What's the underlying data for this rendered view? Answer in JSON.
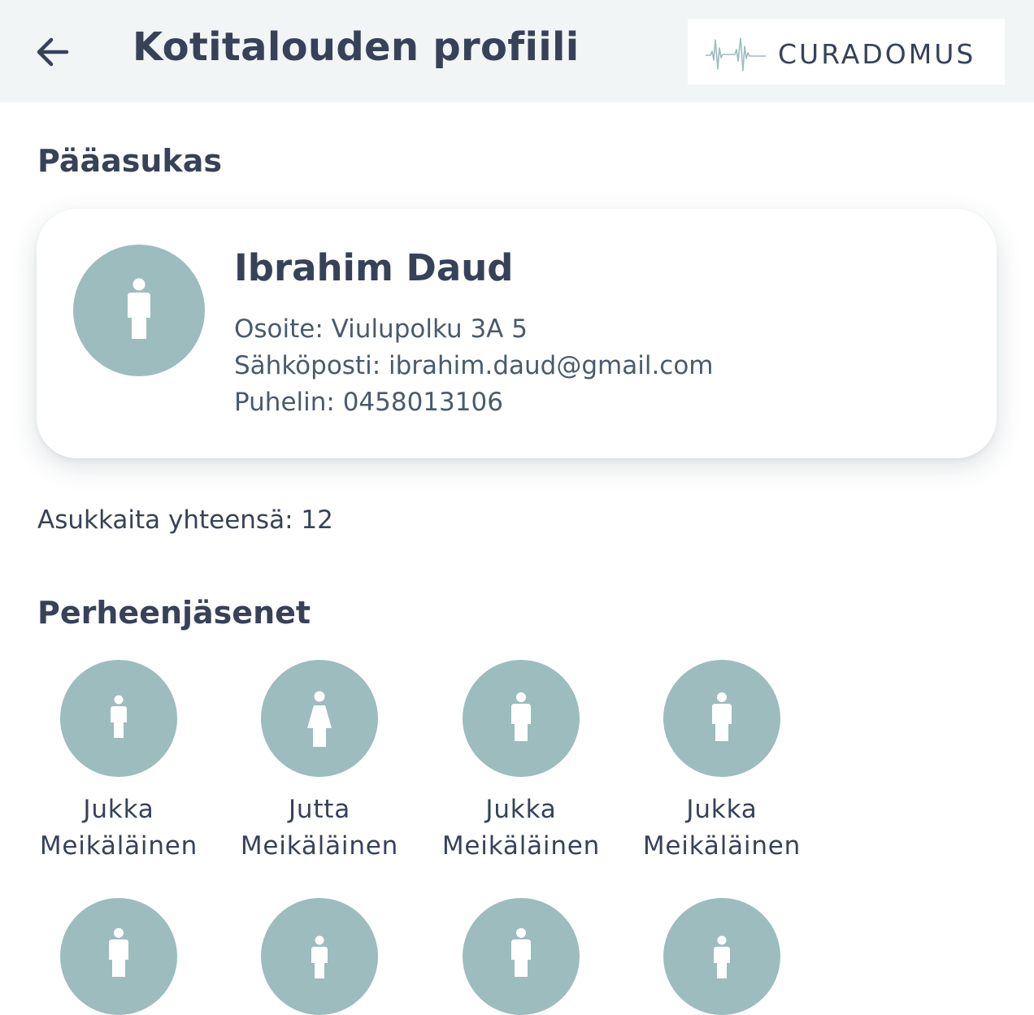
{
  "header": {
    "title": "Kotitalouden profiili",
    "back_icon": "arrow-left-icon",
    "logo_text": "CURADOMUS"
  },
  "main_resident": {
    "heading": "Pääasukas",
    "name": "Ibrahim Daud",
    "address": "Osoite: Viulupolku 3A 5",
    "email": "Sähköposti: ibrahim.daud@gmail.com",
    "phone": "Puhelin: 0458013106",
    "avatar_icon": "male-person-icon"
  },
  "resident_count": "Asukkaita yhteensä: 12",
  "family": {
    "heading": "Perheenjäsenet",
    "members": [
      {
        "first": "Jukka",
        "last": "Meikäläinen",
        "icon": "child-person-icon"
      },
      {
        "first": "Jutta",
        "last": "Meikäläinen",
        "icon": "female-person-icon"
      },
      {
        "first": "Jukka",
        "last": "Meikäläinen",
        "icon": "male-person-icon"
      },
      {
        "first": "Jukka",
        "last": "Meikäläinen",
        "icon": "male-person-icon"
      },
      {
        "first": "",
        "last": "",
        "icon": "male-person-icon"
      },
      {
        "first": "",
        "last": "",
        "icon": "child-person-icon"
      },
      {
        "first": "",
        "last": "",
        "icon": "male-person-icon"
      },
      {
        "first": "",
        "last": "",
        "icon": "child-person-icon"
      }
    ]
  },
  "colors": {
    "avatar_bg": "#9dbcbd",
    "header_bg": "#f1f5f6",
    "text": "#374259"
  }
}
